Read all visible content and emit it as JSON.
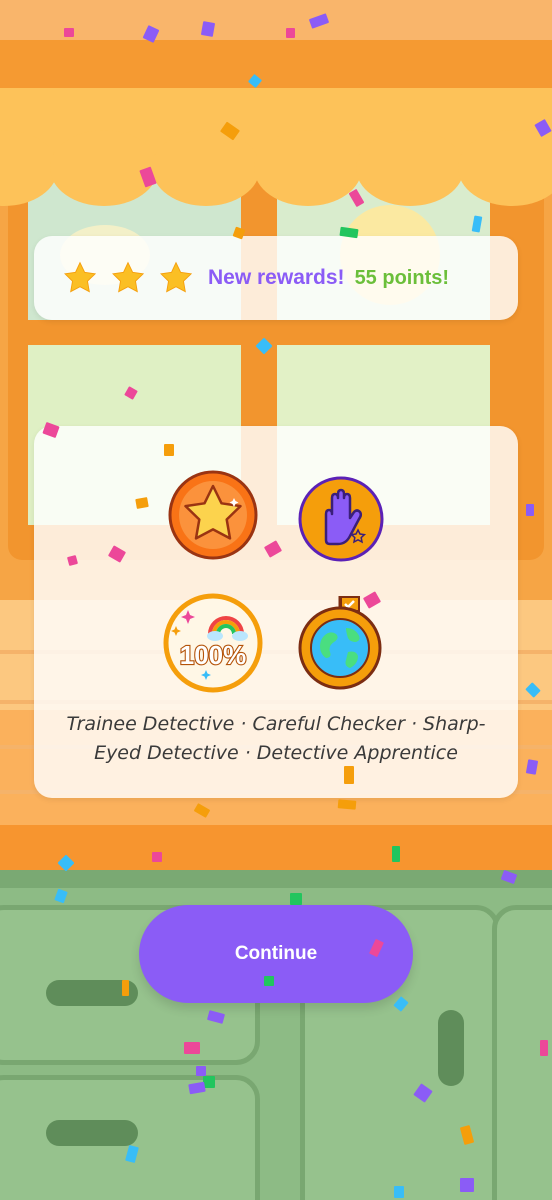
{
  "rewards": {
    "stars": 3,
    "new_rewards_label": "New rewards!",
    "points_label": "55 points!"
  },
  "badges": {
    "items": [
      {
        "icon": "star-badge-icon"
      },
      {
        "icon": "raised-hand-badge-icon"
      },
      {
        "icon": "100-percent-rainbow-badge-icon",
        "text": "100%"
      },
      {
        "icon": "globe-flag-badge-icon"
      }
    ],
    "names_line": "Trainee Detective · Careful Checker · Sharp-Eyed Detective · Detective Apprentice"
  },
  "actions": {
    "continue_label": "Continue"
  },
  "colors": {
    "accent_purple": "#8b5cf6",
    "points_green": "#6bbf3a",
    "star_yellow": "#fbbf24",
    "badge_orange": "#f59e0b"
  }
}
